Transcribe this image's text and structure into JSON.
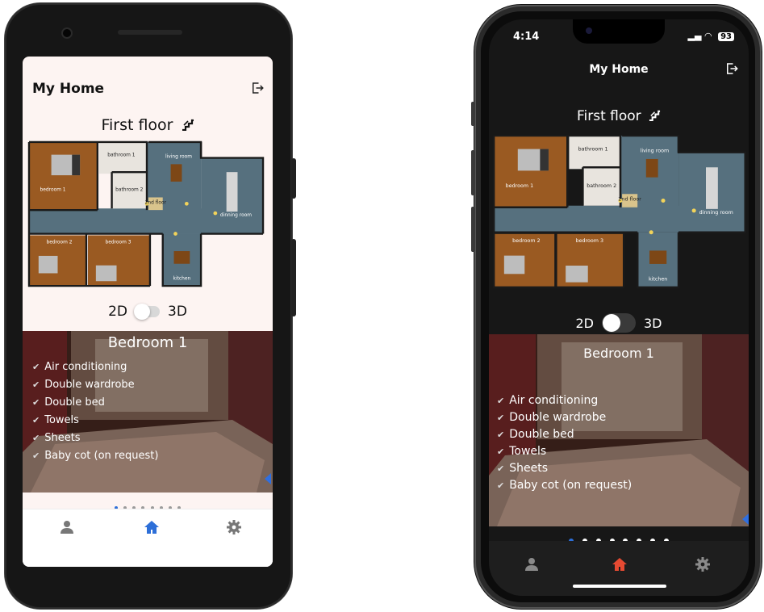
{
  "colors": {
    "android_bg": "#fdf4f2",
    "iphone_bg": "#171717",
    "home_active_android": "#2d6fd8",
    "home_active_iphone": "#e64a32",
    "dot_active": "#2d6fd8",
    "nav_inactive": "#777777"
  },
  "android": {
    "app_title": "My Home",
    "logout_icon": "logout-icon",
    "floor_label": "First floor",
    "floor_icon": "stairs-icon",
    "toggle": {
      "left": "2D",
      "right": "3D",
      "state": "2D"
    },
    "room": {
      "name": "Bedroom 1",
      "amenities": [
        "Air conditioning",
        "Double wardrobe",
        "Double bed",
        "Towels",
        "Sheets",
        "Baby cot (on request)"
      ]
    },
    "pager": {
      "count": 8,
      "active": 0
    },
    "nav": [
      {
        "icon": "person-icon",
        "active": false
      },
      {
        "icon": "home-icon",
        "active": true
      },
      {
        "icon": "gear-icon",
        "active": false
      }
    ]
  },
  "iphone": {
    "time": "4:14",
    "battery": "93",
    "app_title": "My Home",
    "floor_label": "First floor",
    "toggle": {
      "left": "2D",
      "right": "3D",
      "state": "2D"
    },
    "room": {
      "name": "Bedroom 1",
      "amenities": [
        "Air conditioning",
        "Double wardrobe",
        "Double bed",
        "Towels",
        "Sheets",
        "Baby cot (on request)"
      ]
    },
    "pager": {
      "count": 8,
      "active": 0
    },
    "nav": [
      {
        "icon": "person-icon",
        "active": false
      },
      {
        "icon": "home-icon",
        "active": true
      },
      {
        "icon": "gear-icon",
        "active": false
      }
    ]
  },
  "floorplan": {
    "rooms": {
      "bedroom1": "bedroom 1",
      "bathroom1": "bathroom 1",
      "bathroom2": "bathroom 2",
      "living": "living room",
      "stairs": "2nd floor",
      "dinning": "dinning room",
      "bedroom2": "bedroom 2",
      "bedroom3": "bedroom 3",
      "kitchen": "kitchen"
    }
  }
}
